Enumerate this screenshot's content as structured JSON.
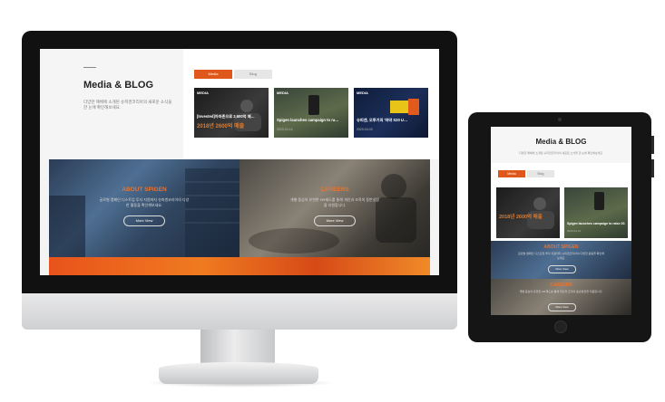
{
  "desktop": {
    "header": {
      "title": "Media & BLOG",
      "description": "다양한 매체에 소개된 슈피겐코리아의 새로운 소식을 한 눈에 확인해보세요."
    },
    "tabs": [
      {
        "label": "Media",
        "active": true
      },
      {
        "label": "Blog",
        "active": false
      }
    ],
    "cards": [
      {
        "tag": "MEDIA",
        "title": "[Invested]아마존으로 2,600억 매…",
        "overlay": "2018년 2600억 매출",
        "date": ""
      },
      {
        "tag": "MEDIA",
        "title": "Spigen launches campaign to ra…",
        "date": "2020.04.14"
      },
      {
        "tag": "MEDIA",
        "title": "슈피겐, 오투기의 '마약 S20 U…",
        "date": "2020.04.03"
      }
    ],
    "about": {
      "heading": "ABOUT SPIGEN",
      "text": "글로벌 캠페인 디스트업 투자 지원까지 슈피겐코리아의 다양한 활동을 확인해보세요.",
      "button": "More View"
    },
    "careers": {
      "heading": "CAREERS",
      "text": "개별 중심의 유연한 HR제도를 통해 개인과 조직의 동반성장을 지원합니다.",
      "button": "More View"
    }
  },
  "tablet": {
    "header": {
      "title": "Media & BLOG",
      "description": "다양한 매체에 소개된 슈피겐코리아의 새로운 소식을 한 눈에 확인해보세요."
    },
    "tabs": [
      {
        "label": "Media",
        "active": true
      },
      {
        "label": "Blog",
        "active": false
      }
    ],
    "cards": [
      {
        "title": "2018년 2600억 매출",
        "date": ""
      },
      {
        "title": "Spigen launches campaign to raise 20…",
        "date": "2020.04.14"
      }
    ],
    "about": {
      "heading": "ABOUT SPIGEN",
      "text": "글로벌 캠페인 디스트업 투자 지원까지 슈피겐코리아의 다양한 활동을 확인해보세요.",
      "button": "More View"
    },
    "careers": {
      "heading": "CAREERS",
      "text": "개별 중심의 유연한 HR제도를 통해 개인과 조직의 동반성장을 지원합니다.",
      "button": "More View"
    }
  },
  "colors": {
    "accent": "#e0571b",
    "heading_orange": "#e9742f",
    "bezel": "#111111"
  }
}
